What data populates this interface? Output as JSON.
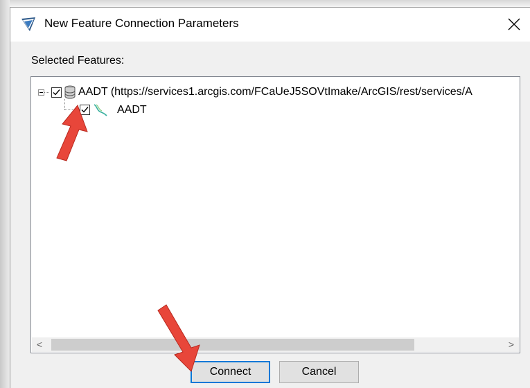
{
  "window": {
    "title": "New Feature Connection Parameters",
    "close_label": "✕"
  },
  "selected_features_label": "Selected Features:",
  "tree": {
    "root": {
      "label": "AADT (https://services1.arcgis.com/FCaUeJ5SOVtImake/ArcGIS/rest/services/A",
      "checked": true,
      "icon": "database-icon"
    },
    "child": {
      "label": "AADT",
      "checked": true,
      "icon": "polyline-layer-icon"
    }
  },
  "scrollbar": {
    "left_arrow": "<",
    "right_arrow": ">"
  },
  "buttons": {
    "connect": "Connect",
    "cancel": "Cancel"
  },
  "colors": {
    "accent": "#0078d7",
    "annotation_arrow": "#e8463a"
  }
}
